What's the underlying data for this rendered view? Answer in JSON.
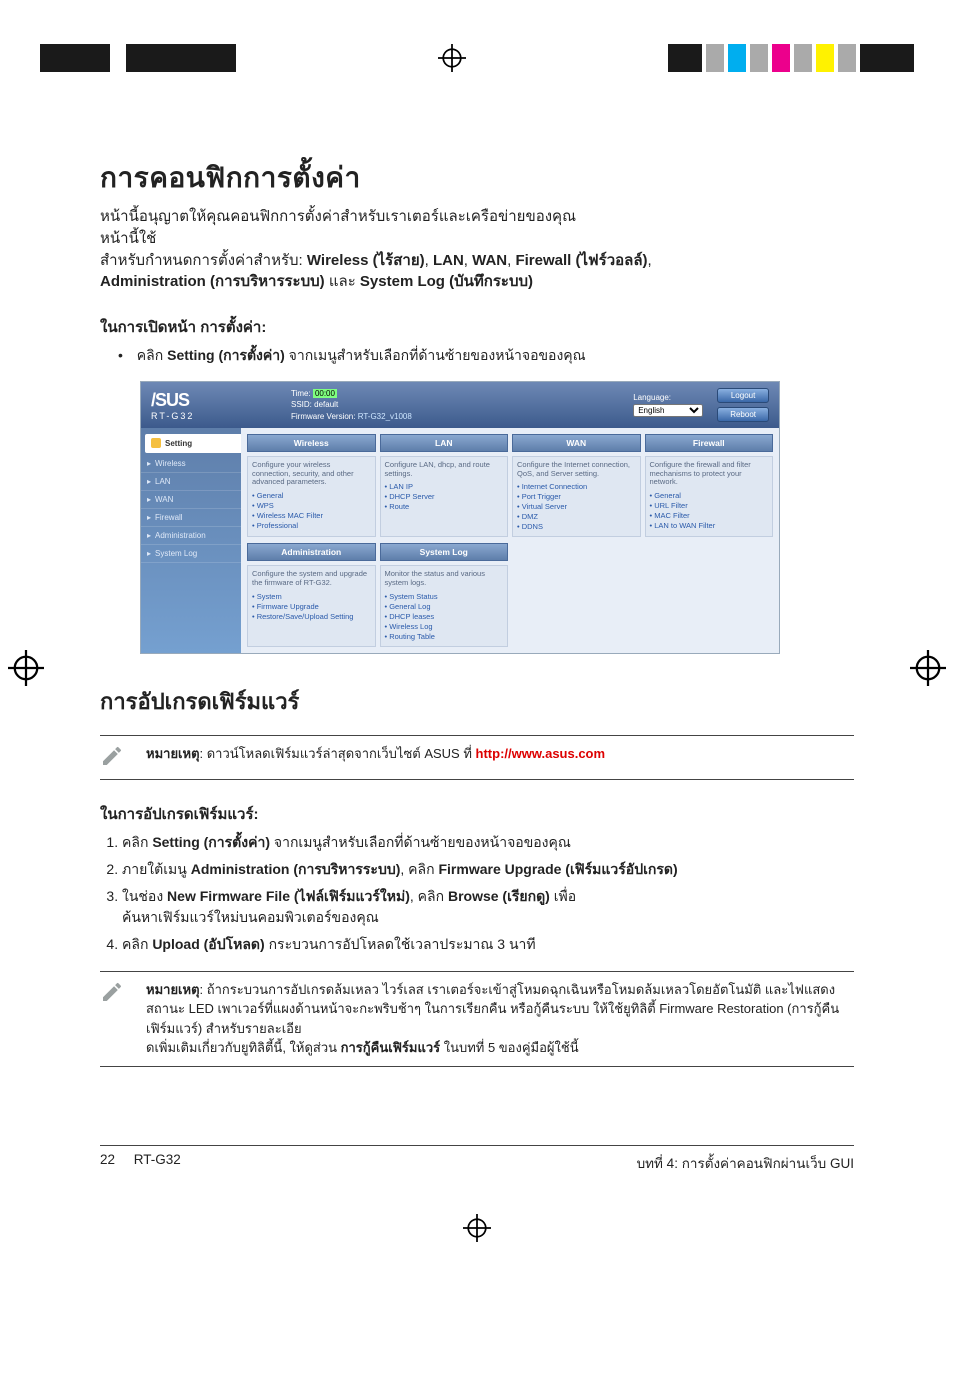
{
  "doc": {
    "title": "การคอนฟิกการตั้งค่า",
    "intro_line1": "หน้านี้อนุญาตให้คุณคอนฟิกการตั้งค่าสำหรับเราเตอร์และเครือข่ายของคุณ",
    "intro_line2": "หน้านี้ใช้",
    "intro_line3_pre": "สำหรับกำหนดการตั้งค่าสำหรับ: ",
    "wireless": "Wireless (ไร้สาย)",
    "lan": "LAN",
    "wan": "WAN",
    "firewall": "Firewall (ไฟร์วอลล์)",
    "comma": ", ",
    "admin": "Administration (การบริหารระบบ)",
    "and": " และ ",
    "syslog": "System Log (บันทึกระบบ)",
    "open_heading": "ในการเปิดหน้า การตั้งค่า:",
    "bullet1_pre": "คลิก ",
    "bullet1_bold": "Setting (การตั้งค่า)",
    "bullet1_post": " จากเมนูสำหรับเลือกที่ด้านซ้ายของหน้าจอของคุณ",
    "fw_title": "การอัปเกรดเฟิร์มแวร์",
    "note1_label": "หมายเหตุ",
    "note1_text": ": ดาวน์โหลดเฟิร์มแวร์ล่าสุดจากเว็บไซต์ ASUS ที่ ",
    "note1_url": "http://www.asus.com",
    "fw_heading": "ในการอัปเกรดเฟิร์มแวร์:",
    "s1_pre": "คลิก ",
    "s1_bold": "Setting (การตั้งค่า)",
    "s1_post": " จากเมนูสำหรับเลือกที่ด้านซ้ายของหน้าจอของคุณ",
    "s2_pre": "ภายใต้เมนู ",
    "s2_b1": "Administration (การบริหารระบบ)",
    "s2_mid": ", คลิก ",
    "s2_b2": "Firmware Upgrade (เฟิร์มแวร์อัปเกรด)",
    "s3_pre": "ในช่อง ",
    "s3_b1": "New Firmware File (ไฟล์เฟิร์มแวร์ใหม่)",
    "s3_mid": ", คลิก ",
    "s3_b2": "Browse (เรียกดู)",
    "s3_post": " เพื่อ",
    "s3_line2": "ค้นหาเฟิร์มแวร์ใหม่บนคอมพิวเตอร์ของคุณ",
    "s4_pre": "คลิก ",
    "s4_bold": "Upload (อัปโหลด)",
    "s4_post": " กระบวนการอัปโหลดใช้เวลาประมาณ 3 นาที",
    "note2_label": "หมายเหตุ",
    "note2_p1": ": ถ้ากระบวนการอัปเกรดล้มเหลว ไวร์เลส เราเตอร์จะเข้าสู่โหมดฉุกเฉินหรือโหมดล้มเหลวโดยอัตโนมัติ และไฟแสดงสถานะ LED เพาเวอร์ที่แผงด้านหน้าจะกะพริบช้าๆ ในการเรียกคืน หรือกู้คืนระบบ ให้ใช้ยูทิลิตี้ Firmware Restoration (การกู้คืนเฟิร์มแวร์) สำหรับรายละเอีย",
    "note2_p2_pre": "ดเพิ่มเติมเกี่ยวกับยูทิลิตี้นี้, ให้ดูส่วน ",
    "note2_p2_bold": "การกู้คืนเฟิร์มแวร์",
    "note2_p2_post": " ในบทที่ 5 ของคู่มือผู้ใช้นี้"
  },
  "router": {
    "brand_text": "/SUS",
    "model": "RT-G32",
    "time_label": "Time:",
    "time_value": "00:00",
    "ssid_label": "SSID:",
    "ssid_value": "default",
    "fw_label": "Firmware Version:",
    "fw_value": "RT-G32_v1008",
    "lang_label": "Language:",
    "lang_value": "English",
    "btn_logout": "Logout",
    "btn_reboot": "Reboot",
    "side": {
      "setting": "Setting",
      "wireless": "Wireless",
      "lan": "LAN",
      "wan": "WAN",
      "firewall": "Firewall",
      "admin": "Administration",
      "syslog": "System Log"
    },
    "cards": {
      "wireless": {
        "title": "Wireless",
        "desc": "Configure your wireless connection, security, and other advanced parameters.",
        "items": [
          "General",
          "WPS",
          "Wireless MAC Filter",
          "Professional"
        ]
      },
      "lan": {
        "title": "LAN",
        "desc": "Configure LAN, dhcp, and route settings.",
        "items": [
          "LAN IP",
          "DHCP Server",
          "Route"
        ]
      },
      "wan": {
        "title": "WAN",
        "desc": "Configure the Internet connection, QoS, and Server setting.",
        "items": [
          "Internet Connection",
          "Port Trigger",
          "Virtual Server",
          "DMZ",
          "DDNS"
        ]
      },
      "firewall": {
        "title": "Firewall",
        "desc": "Configure the firewall and filter mechanisms to protect your network.",
        "items": [
          "General",
          "URL Filter",
          "MAC Filter",
          "LAN to WAN Filter"
        ]
      },
      "admin": {
        "title": "Administration",
        "desc": "Configure the system and upgrade the firmware of RT-G32.",
        "items": [
          "System",
          "Firmware Upgrade",
          "Restore/Save/Upload Setting"
        ]
      },
      "syslog": {
        "title": "System Log",
        "desc": "Monitor the status and various system logs.",
        "items": [
          "System Status",
          "General Log",
          "DHCP leases",
          "Wireless Log",
          "Routing Table"
        ]
      }
    }
  },
  "footer": {
    "page": "22",
    "model": "RT-G32",
    "chapter": "บทที่ 4: การตั้งค่าคอนฟิกผ่านเว็บ GUI"
  }
}
